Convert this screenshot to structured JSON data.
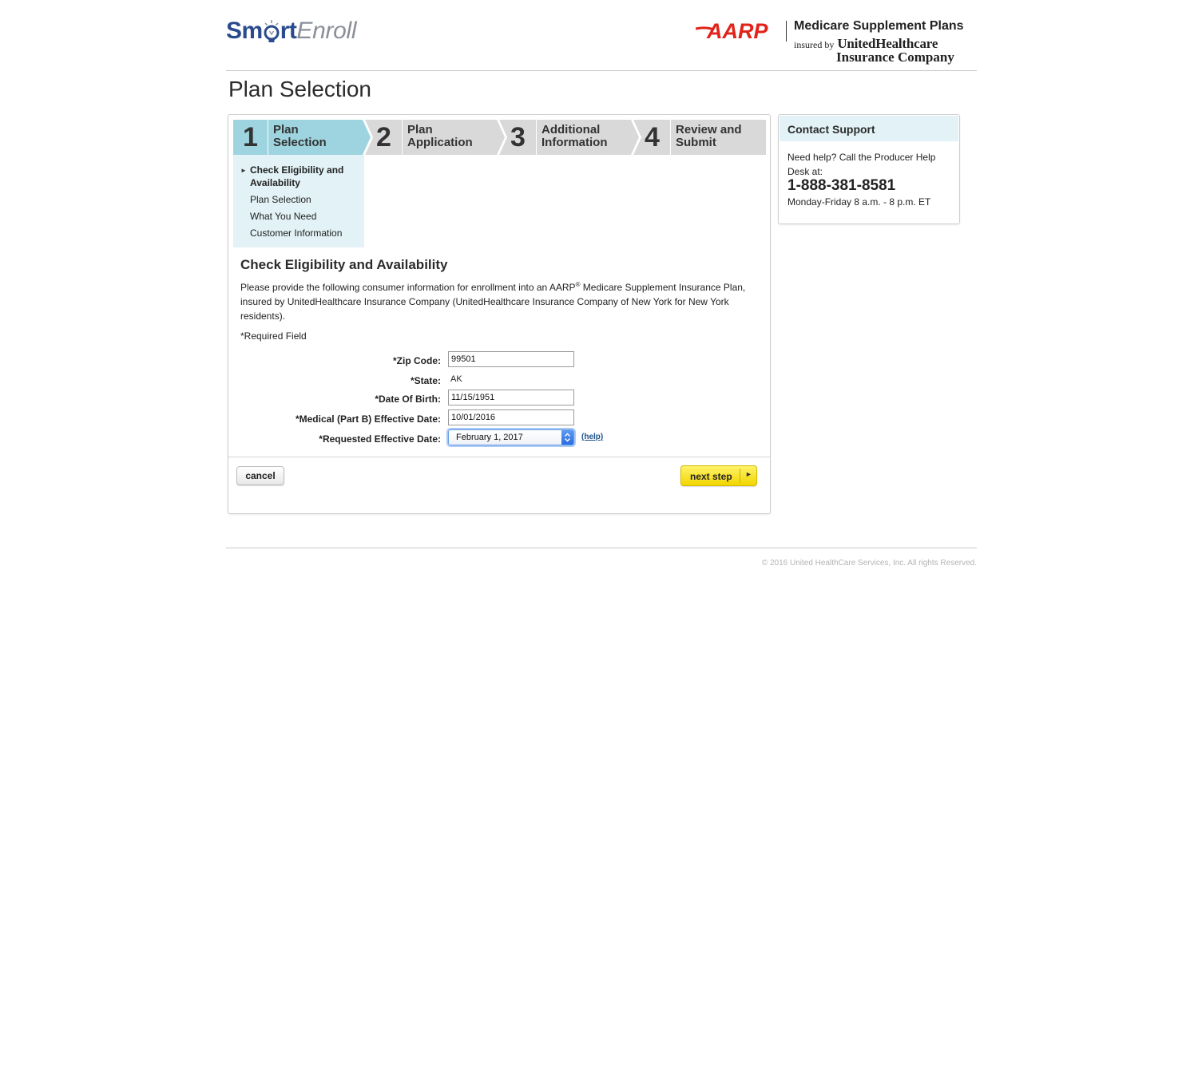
{
  "header": {
    "logo_smart": "Sm",
    "logo_smart2": "rt",
    "logo_enroll": "Enroll",
    "aarp_logo_text": "AARP",
    "aarp_title": "Medicare Supplement Plans",
    "insured_by": "insured by",
    "insurer_line1": "UnitedHealthcare",
    "insurer_line2": "Insurance Company"
  },
  "page_title": "Plan Selection",
  "steps": [
    {
      "number": "1",
      "line1": "Plan",
      "line2": "Selection",
      "active": true
    },
    {
      "number": "2",
      "line1": "Plan",
      "line2": "Application",
      "active": false
    },
    {
      "number": "3",
      "line1": "Additional",
      "line2": "Information",
      "active": false
    },
    {
      "number": "4",
      "line1": "Review and",
      "line2": "Submit",
      "active": false
    }
  ],
  "subnav": {
    "items": [
      {
        "label_line1": "Check Eligibility and",
        "label_line2": "Availability",
        "active": true
      },
      {
        "label": "Plan Selection"
      },
      {
        "label": "What You Need"
      },
      {
        "label": "Customer Information"
      }
    ]
  },
  "section": {
    "title": "Check Eligibility and Availability",
    "intro_part1": "Please provide the following consumer information for enrollment into an AARP",
    "intro_reg": "®",
    "intro_part2": " Medicare Supplement Insurance Plan, insured by UnitedHealthcare Insurance Company (UnitedHealthcare Insurance Company of New York for New York residents).",
    "required_note": "*Required Field"
  },
  "form": {
    "zip_label": "*Zip Code:",
    "zip_value": "99501",
    "state_label": "*State:",
    "state_value": "AK",
    "dob_label": "*Date Of Birth:",
    "dob_value": "11/15/1951",
    "partb_label": "*Medical (Part B) Effective Date:",
    "partb_value": "10/01/2016",
    "req_label": "*Requested Effective Date:",
    "req_value": "February 1, 2017",
    "help": "(help)"
  },
  "buttons": {
    "cancel": "cancel",
    "next": "next step"
  },
  "support": {
    "title": "Contact Support",
    "text": "Need help? Call the Producer Help Desk at:",
    "phone": "1-888-381-8581",
    "hours": "Monday-Friday 8 a.m. - 8 p.m. ET"
  },
  "footer": {
    "copyright": "© 2016 United HealthCare Services, Inc. All rights Reserved."
  },
  "colors": {
    "active_step": "#9dd4df",
    "inactive_step": "#d9d9d9",
    "subnav_bg": "#e2f2f6",
    "brand_blue": "#2a4b8d",
    "aarp_red": "#e2231a",
    "next_button": "#f7e31c"
  }
}
